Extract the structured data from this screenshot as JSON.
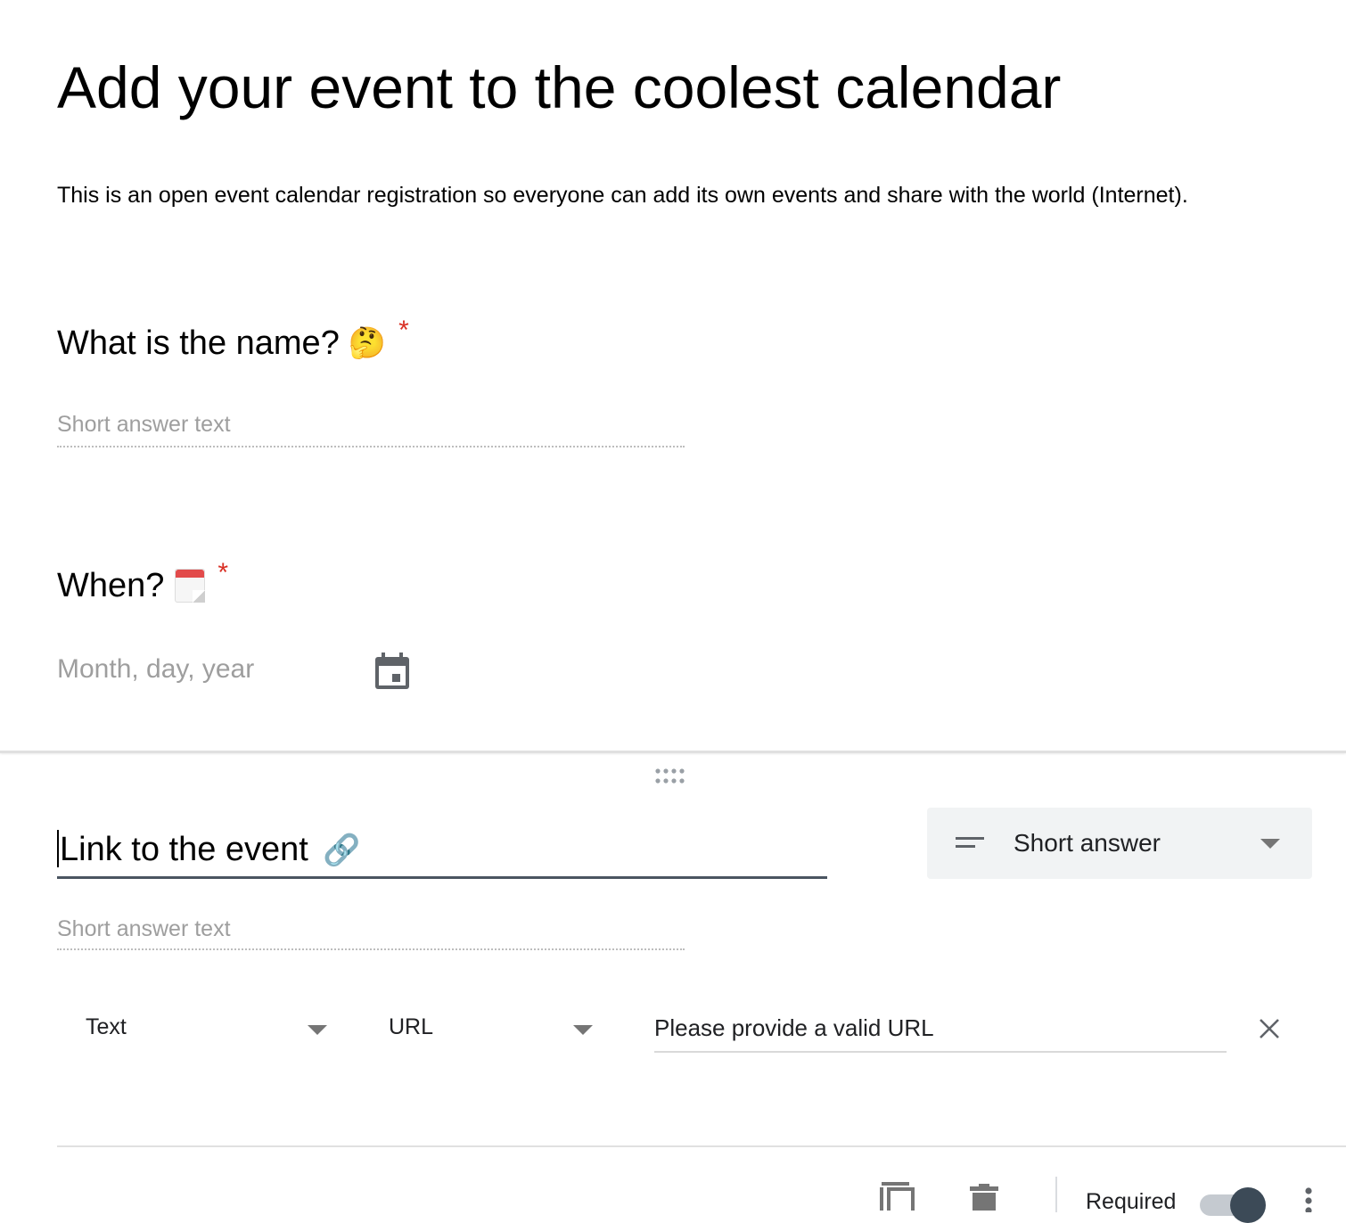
{
  "form": {
    "title": "Add your event to the coolest calendar",
    "description": "This is an open event calendar registration so everyone can add its own events and share with the world (Internet)."
  },
  "questions": [
    {
      "title": "What is the name?",
      "emoji": "🤔",
      "required_mark": "*",
      "placeholder": "Short answer text"
    },
    {
      "title": "When?",
      "emoji": "calendar-emoji",
      "required_mark": "*",
      "placeholder": "Month, day, year"
    }
  ],
  "active_question": {
    "title": "Link to the event",
    "emoji": "🔗",
    "type_label": "Short answer",
    "placeholder": "Short answer text",
    "validation": {
      "category": "Text",
      "rule": "URL",
      "error_text": "Please provide a valid URL"
    },
    "footer": {
      "required_label": "Required",
      "required_on": true
    }
  },
  "icons": {
    "calendar": "calendar-icon",
    "drag": "drag-handle-icon",
    "short_answer": "short-answer-icon",
    "dropdown": "chevron-down-icon",
    "close": "close-icon",
    "duplicate": "duplicate-icon",
    "delete": "delete-icon",
    "more": "more-vert-icon"
  },
  "colors": {
    "required": "#d93025",
    "placeholder": "#9e9e9e",
    "toggle_knob": "#3c4a57"
  }
}
